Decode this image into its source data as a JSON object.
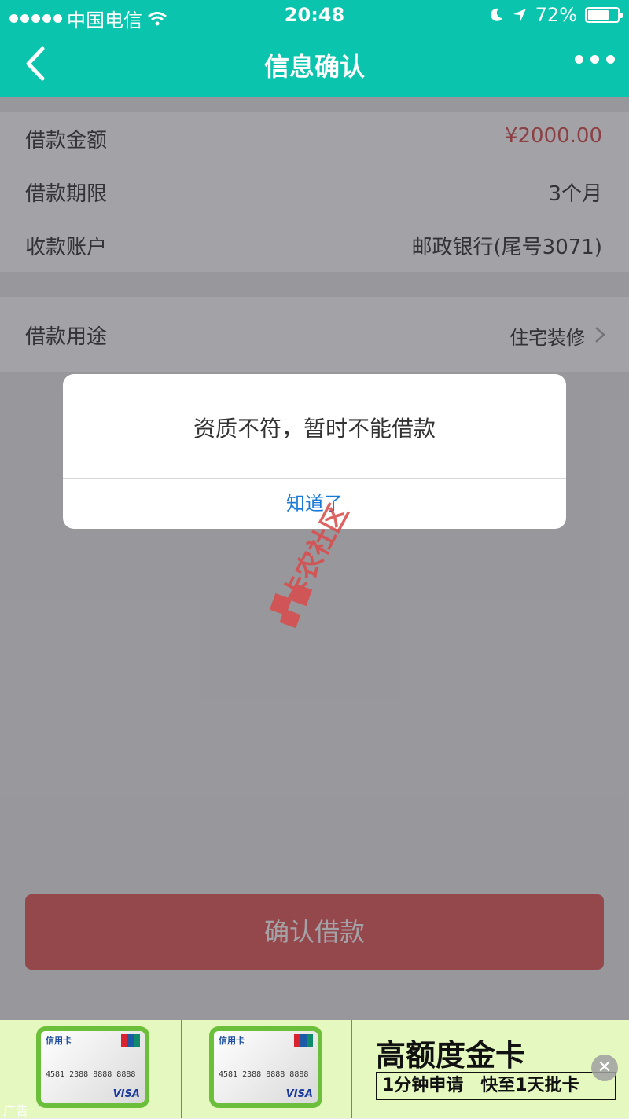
{
  "status_bar": {
    "carrier": "中国电信",
    "time": "20:48",
    "battery_percent": "72%",
    "battery_level": 0.72
  },
  "nav": {
    "title": "信息确认",
    "back_icon": "chevron-left-icon",
    "more_icon": "more-dots-icon"
  },
  "loan_info": {
    "amount_label": "借款金额",
    "amount_value": "¥2000.00",
    "term_label": "借款期限",
    "term_value": "3个月",
    "account_label": "收款账户",
    "account_value": "邮政银行(尾号3071)"
  },
  "purpose": {
    "label": "借款用途",
    "value": "住宅装修"
  },
  "confirm_button": "确认借款",
  "alert": {
    "message": "资质不符，暂时不能借款",
    "ok_label": "知道了"
  },
  "watermark": {
    "text": "卡农社区"
  },
  "ad": {
    "card_label": "信用卡",
    "card_number": "4581 2388 8888 8888",
    "card_brand": "VISA",
    "headline": "高额度金卡",
    "subline": "1分钟申请　快至1天批卡",
    "ad_tag": "广告",
    "close_icon": "close-icon"
  },
  "colors": {
    "brand": "#0ac4ad",
    "amount": "#d34b4b",
    "confirm_button": "#e45a5a",
    "link": "#1a7ad8"
  }
}
